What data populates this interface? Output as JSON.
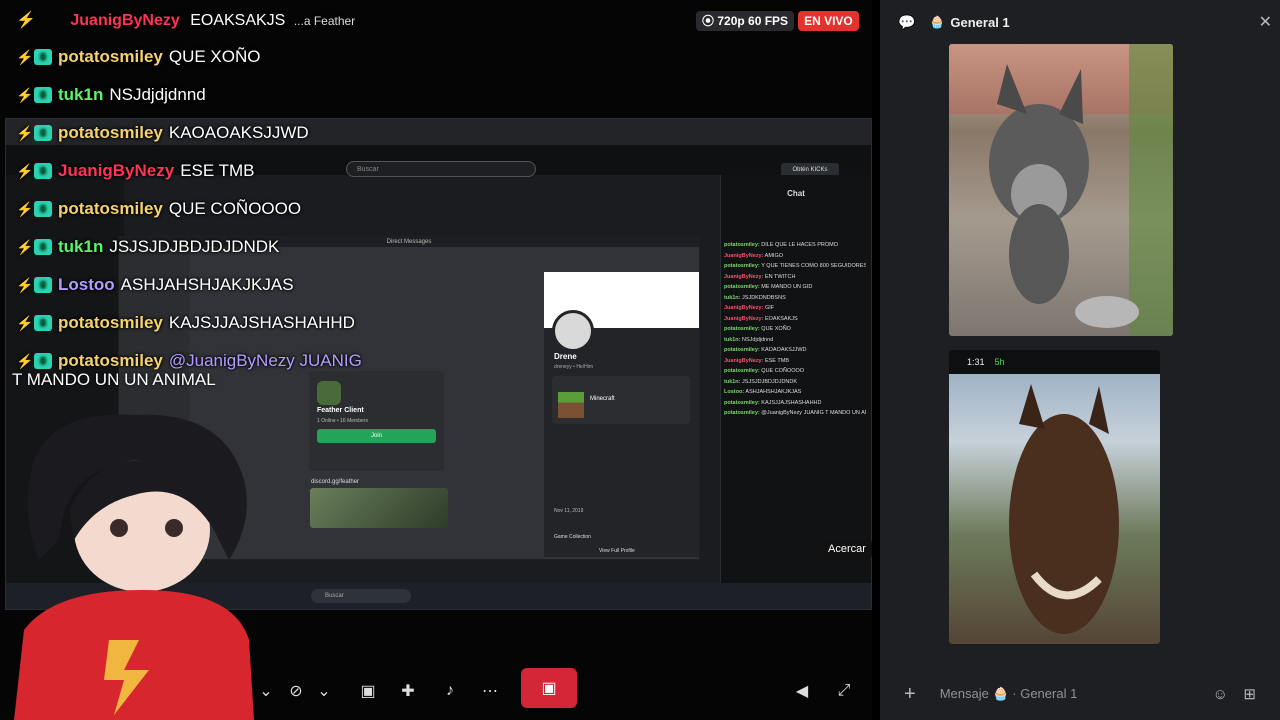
{
  "stream_header": {
    "top_user": "JuanigByNezy",
    "top_text": "EOAKSAKJS",
    "overlay_notice": "...a Feather",
    "quality": "720p 60 FPS",
    "live_label": "EN VIVO"
  },
  "overlay_chat": [
    {
      "user": "potatosmiley",
      "text": "QUE XOÑO",
      "color": "yellow"
    },
    {
      "user": "tuk1n",
      "text": "NSJdjdjdnnd",
      "color": "green"
    },
    {
      "user": "potatosmiley",
      "text": "KAOAOAKSJJWD",
      "color": "yellow"
    },
    {
      "user": "JuanigByNezy",
      "text": "ESE TMB",
      "color": "red"
    },
    {
      "user": "potatosmiley",
      "text": "QUE COÑOOOO",
      "color": "yellow"
    },
    {
      "user": "tuk1n",
      "text": "JSJSJDJBDJDJDNDK",
      "color": "green"
    },
    {
      "user": "Lostoo",
      "text": "ASHJAHSHJAKJKJAS",
      "color": "purple"
    },
    {
      "user": "potatosmiley",
      "text": "KAJSJJAJSHASHAHHD",
      "color": "yellow"
    },
    {
      "user": "potatosmiley",
      "text": "@JuanigByNezy JUANIG",
      "color": "yellow",
      "mention": true
    }
  ],
  "overlay_chat_continuation": "T MANDO UN UN ANIMAL",
  "screen": {
    "search_placeholder": "Buscar",
    "obtain_label": "Obtén KICKs",
    "chat_title": "Chat",
    "dm_title": "Direct Messages",
    "profile_name": "Drene",
    "profile_tag": "dreneyy • He/Him",
    "playing_game": "Minecraft",
    "invite_name": "Feather Client",
    "invite_sub": "1 Online • 16 Members",
    "join_label": "Join",
    "invite_link": "discord.gg/feather",
    "taskbar_search": "Buscar",
    "member_since": "Nov 11, 2019",
    "game_collection": "Game Collection",
    "view_profile": "View Full Profile",
    "tooltip": "Acercar"
  },
  "screen_chat": [
    {
      "user": "potatosmiley:",
      "text": "DILE QUE LE HACES PROMO"
    },
    {
      "user": "JuanigByNezy:",
      "text": "AMIGO",
      "red": true
    },
    {
      "user": "potatosmiley:",
      "text": "Y QUE TIENES COMO 800 SEGUIDORES"
    },
    {
      "user": "JuanigByNezy:",
      "text": "EN TWITCH",
      "red": true
    },
    {
      "user": "potatosmiley:",
      "text": "ME MANDO UN GID"
    },
    {
      "user": "tuk1n:",
      "text": "JSJDKDNDBSNS"
    },
    {
      "user": "JuanigByNezy:",
      "text": "GIF",
      "red": true
    },
    {
      "user": "JuanigByNezy:",
      "text": "EOAKSAKJS",
      "red": true
    },
    {
      "user": "potatosmiley:",
      "text": "QUE XOÑO"
    },
    {
      "user": "tuk1n:",
      "text": "NSJdjdjdnnd"
    },
    {
      "user": "potatosmiley:",
      "text": "KAOAOAKSJJWD"
    },
    {
      "user": "JuanigByNezy:",
      "text": "ESE TMB",
      "red": true
    },
    {
      "user": "potatosmiley:",
      "text": "QUE COÑOOOO"
    },
    {
      "user": "tuk1n:",
      "text": "JSJSJDJBDJDJDNDK"
    },
    {
      "user": "Lostoo:",
      "text": "ASHJAHSHJAKJKJAS"
    },
    {
      "user": "potatosmiley:",
      "text": "KAJSJJAJSHASHAHHD"
    },
    {
      "user": "potatosmiley:",
      "text": "@JuanigByNezy JUANIG T MANDO UN ANIMAL"
    }
  ],
  "bottom_controls": {
    "icons": [
      "chevron-down-icon",
      "camera-off-icon",
      "screen-share-icon",
      "activities-icon",
      "soundboard-icon",
      "more-icon",
      "end-call-icon",
      "volume-icon",
      "fullscreen-icon"
    ]
  },
  "side_panel": {
    "channel_name": "General 1",
    "phone_time": "1:31",
    "phone_timer": "5h",
    "composer_placeholder_prefix": "Mensaje",
    "composer_channel": "General 1"
  },
  "colors": {
    "live_red": "#e5322f",
    "end_call_red": "#d32738",
    "accent_green": "#23a559",
    "username_yellow": "#f5d26b",
    "username_red": "#ff3355"
  }
}
